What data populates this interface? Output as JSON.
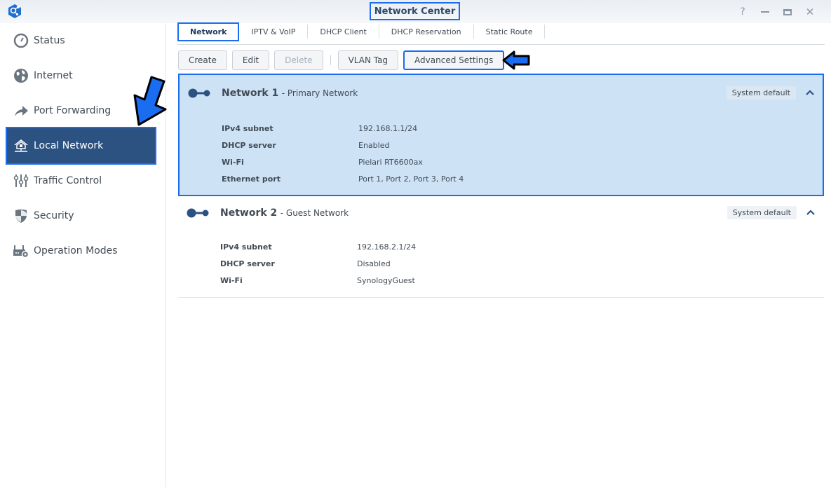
{
  "window": {
    "title": "Network Center",
    "controls": [
      "help",
      "minimize",
      "maximize",
      "close"
    ]
  },
  "sidebar": {
    "items": [
      {
        "label": "Status",
        "icon": "gauge-icon",
        "active": false
      },
      {
        "label": "Internet",
        "icon": "globe-icon",
        "active": false
      },
      {
        "label": "Port Forwarding",
        "icon": "forward-arrow-icon",
        "active": false
      },
      {
        "label": "Local Network",
        "icon": "home-network-icon",
        "active": true
      },
      {
        "label": "Traffic Control",
        "icon": "sliders-icon",
        "active": false
      },
      {
        "label": "Security",
        "icon": "shield-icon",
        "active": false
      },
      {
        "label": "Operation Modes",
        "icon": "router-gear-icon",
        "active": false
      }
    ]
  },
  "tabs": [
    {
      "label": "Network",
      "active": true
    },
    {
      "label": "IPTV & VoIP",
      "active": false
    },
    {
      "label": "DHCP Client",
      "active": false
    },
    {
      "label": "DHCP Reservation",
      "active": false
    },
    {
      "label": "Static Route",
      "active": false
    }
  ],
  "toolbar": {
    "create": "Create",
    "edit": "Edit",
    "delete": "Delete",
    "vlan_tag": "VLAN Tag",
    "advanced_settings": "Advanced Settings"
  },
  "networks": [
    {
      "name": "Network 1",
      "subtitle": "- Primary Network",
      "badge": "System default",
      "selected": true,
      "rows": [
        {
          "key": "IPv4 subnet",
          "value": "192.168.1.1/24"
        },
        {
          "key": "DHCP server",
          "value": "Enabled"
        },
        {
          "key": "Wi-Fi",
          "value": "Pielari RT6600ax"
        },
        {
          "key": "Ethernet port",
          "value": "Port 1, Port 2, Port 3, Port 4"
        }
      ]
    },
    {
      "name": "Network 2",
      "subtitle": "- Guest Network",
      "badge": "System default",
      "selected": false,
      "rows": [
        {
          "key": "IPv4 subnet",
          "value": "192.168.2.1/24"
        },
        {
          "key": "DHCP server",
          "value": "Disabled"
        },
        {
          "key": "Wi-Fi",
          "value": "SynologyGuest"
        }
      ]
    }
  ],
  "colors": {
    "accent": "#1a6cf0",
    "sidebar_active": "#2c5282",
    "selected_card": "#cde2f5"
  }
}
